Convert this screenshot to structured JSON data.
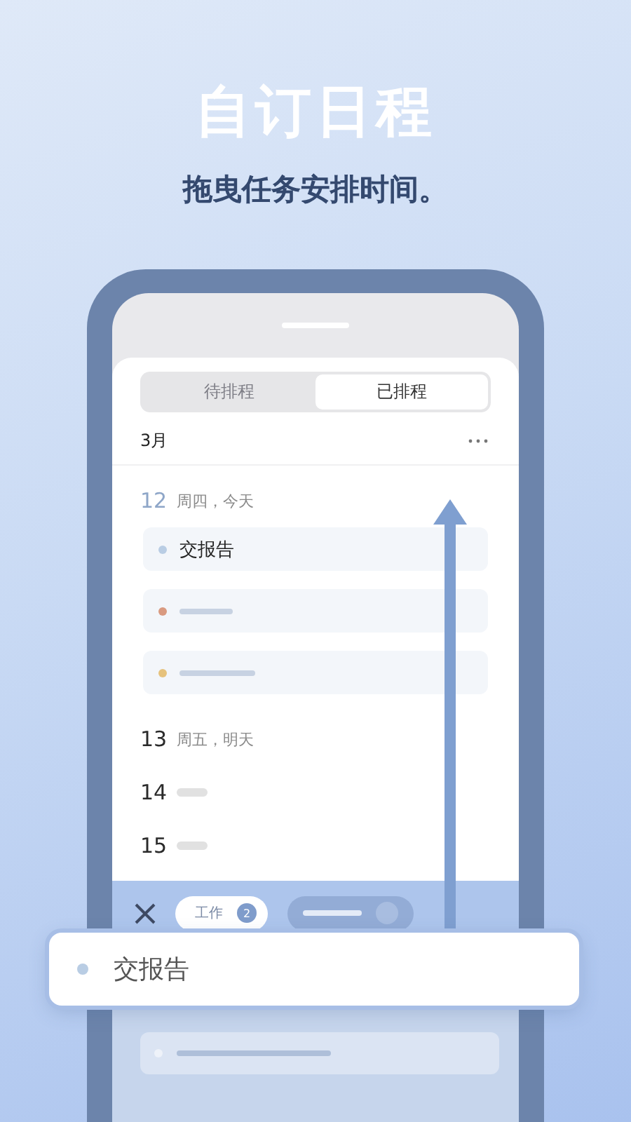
{
  "headline": "自订日程",
  "subtitle": "拖曳任务安排时间。",
  "tabs": [
    {
      "label": "待排程",
      "selected": false
    },
    {
      "label": "已排程",
      "selected": true
    }
  ],
  "month": "3月",
  "days": [
    {
      "date": "12",
      "label": "周四，今天",
      "today": true,
      "tasks": [
        {
          "kind": "text",
          "title": "交报告",
          "color": "#b9cde4"
        },
        {
          "kind": "placeholder",
          "color": "#d99a80"
        },
        {
          "kind": "placeholder",
          "color": "#e6c27c"
        }
      ]
    },
    {
      "date": "13",
      "label": "周五，明天",
      "today": false
    },
    {
      "date": "14",
      "today": false,
      "placeholder": true
    },
    {
      "date": "15",
      "today": false,
      "placeholder": true
    }
  ],
  "filter_chip": {
    "label": "工作",
    "count": "2"
  },
  "dragged_task": {
    "title": "交报告",
    "color": "#b9cde4"
  }
}
